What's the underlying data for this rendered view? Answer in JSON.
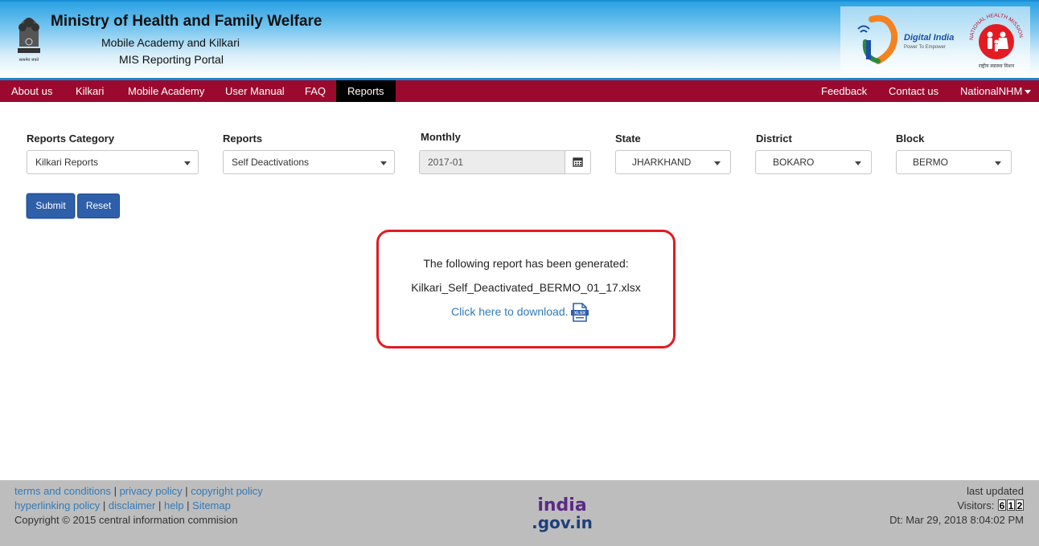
{
  "header": {
    "title": "Ministry of Health and Family Welfare",
    "subtitle1": "Mobile Academy and Kilkari",
    "subtitle2": "MIS Reporting Portal",
    "emblem_caption": "सत्यमेव जयते",
    "digital_india_title": "Digital India",
    "digital_india_tagline": "Power To Empower",
    "nhm_ring_text": "NATIONAL HEALTH MISSION",
    "nhm_hindi": "राष्ट्रीय स्वास्थ्य मिशन"
  },
  "nav": {
    "left": [
      "About us",
      "Kilkari",
      "Mobile Academy",
      "User Manual",
      "FAQ",
      "Reports"
    ],
    "active": "Reports",
    "right": [
      "Feedback",
      "Contact us"
    ],
    "user": "NationalNHM"
  },
  "form": {
    "reports_category": {
      "label": "Reports Category",
      "value": "Kilkari Reports"
    },
    "reports": {
      "label": "Reports",
      "value": "Self Deactivations"
    },
    "monthly": {
      "label": "Monthly",
      "value": "2017-01"
    },
    "state": {
      "label": "State",
      "value": "JHARKHAND"
    },
    "district": {
      "label": "District",
      "value": "BOKARO"
    },
    "block": {
      "label": "Block",
      "value": "BERMO"
    },
    "submit_label": "Submit",
    "reset_label": "Reset"
  },
  "result": {
    "message": "The following report has been generated:",
    "filename": "Kilkari_Self_Deactivated_BERMO_01_17.xlsx",
    "download_text": "Click here to download.",
    "icon_text": "XLSX"
  },
  "footer": {
    "links_row1": [
      "terms and conditions",
      "privacy policy",
      "copyright policy"
    ],
    "links_row2": [
      "hyperlinking policy",
      "disclaimer",
      "help",
      "Sitemap"
    ],
    "copyright": "Copyright © 2015 central information commision",
    "last_updated": "last updated",
    "visitors_label": "Visitors:",
    "visitor_digits": [
      "6",
      "1",
      "2"
    ],
    "date": "Dt: Mar 29, 2018 8:04:02 PM",
    "india_logo_top": "india",
    "india_logo_bottom": ".gov.in"
  },
  "colors": {
    "navbar": "#9b0a2e",
    "nav_active": "#000000",
    "button": "#2f5fa9",
    "highlight_border": "#e11b22",
    "link": "#337ab7",
    "footer": "#bdbdbd"
  }
}
